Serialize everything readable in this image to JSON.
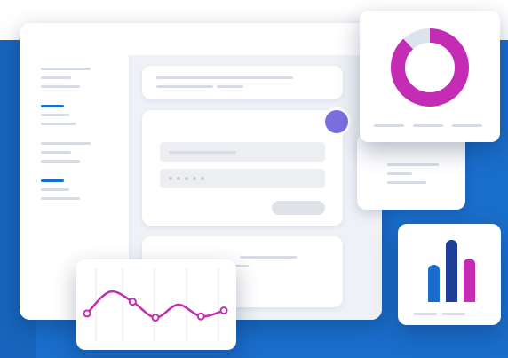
{
  "illustration": {
    "colors": {
      "background": "#1a6ecb",
      "accent_purple": "#7b6fe0",
      "magenta": "#c32cb3",
      "blue": "#1a6ecb",
      "navy": "#1f3e9a",
      "placeholder": "#d7dce4"
    },
    "password_mask": "•••••",
    "donut": {
      "filled_fraction": 0.88
    },
    "bars": [
      0.6,
      1.0,
      0.7
    ],
    "line_points": [
      0.35,
      0.72,
      0.55,
      0.28,
      0.5,
      0.3,
      0.4
    ]
  }
}
